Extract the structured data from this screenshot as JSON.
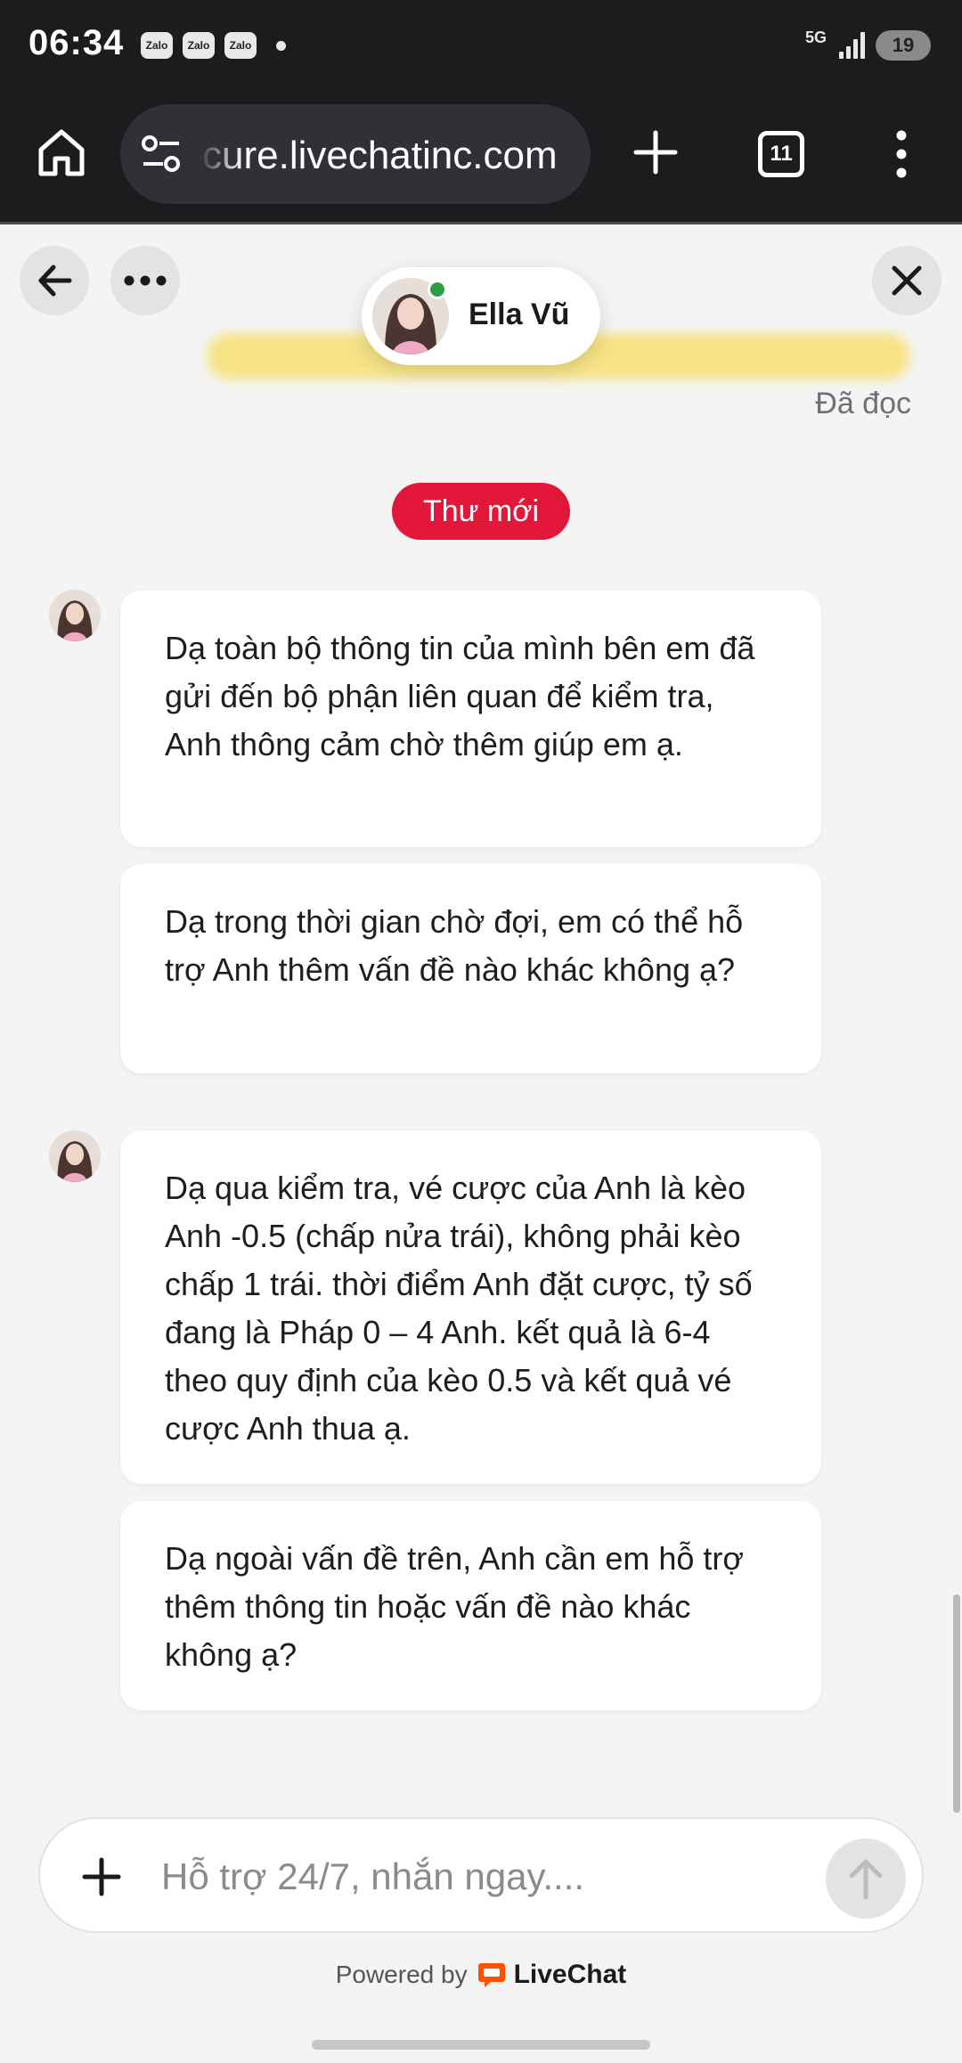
{
  "status_bar": {
    "time": "06:34",
    "notification_apps": [
      "Zalo",
      "Zalo",
      "Zalo"
    ],
    "network": "5G",
    "battery": "19"
  },
  "browser": {
    "url": "cure.livechatinc.com",
    "tab_count": "11"
  },
  "chat_header": {
    "agent_name": "Ella Vũ",
    "agent_status": "online",
    "read_status": "Đã đọc",
    "new_messages_badge": "Thư mới"
  },
  "messages": [
    {
      "sender": "Ella Vũ",
      "text": "Dạ toàn bộ thông tin của mình bên em đã gửi đến bộ phận liên quan để kiểm tra, Anh thông cảm chờ thêm giúp em ạ."
    },
    {
      "sender": "Ella Vũ",
      "text": "Dạ trong thời gian chờ đợi, em có thể hỗ trợ Anh thêm vấn đề nào khác không ạ?"
    },
    {
      "sender": "Ella Vũ",
      "text": "Dạ qua kiểm tra, vé cược của Anh là kèo Anh -0.5 (chấp nửa trái), không phải kèo chấp 1 trái. thời điểm Anh đặt cược, tỷ số đang là Pháp 0 – 4 Anh. kết quả là 6-4 theo quy định của kèo 0.5 và kết quả vé cược Anh thua ạ."
    },
    {
      "sender": "Ella Vũ",
      "text": "Dạ ngoài vấn đề trên, Anh cần em hỗ trợ thêm thông tin hoặc vấn đề nào khác không ạ?"
    }
  ],
  "composer": {
    "placeholder": "Hỗ trợ 24/7, nhắn ngay....",
    "value": ""
  },
  "footer": {
    "powered_by": "Powered by",
    "brand": "LiveChat"
  },
  "colors": {
    "badge": "#e2173a",
    "online": "#2e9e44",
    "livechat_orange": "#ff5100"
  }
}
